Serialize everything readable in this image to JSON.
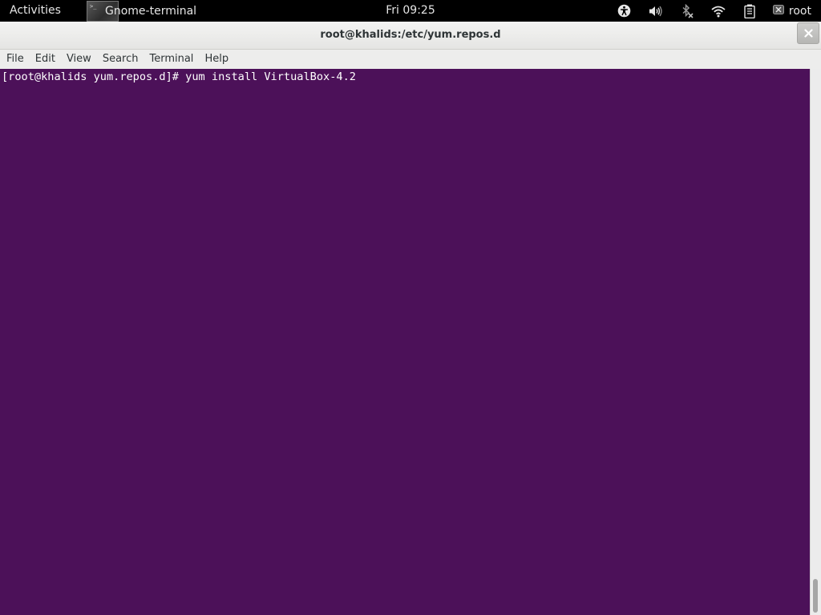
{
  "topbar": {
    "activities": "Activities",
    "app_name": "Gnome-terminal",
    "app_icon_prompt": ">_",
    "clock": "Fri 09:25",
    "user": "root"
  },
  "window": {
    "title": "root@khalids:/etc/yum.repos.d"
  },
  "menu": {
    "items": [
      "File",
      "Edit",
      "View",
      "Search",
      "Terminal",
      "Help"
    ]
  },
  "terminal": {
    "lines": [
      "[root@khalids yum.repos.d]# yum install VirtualBox-4.2"
    ],
    "background": "#4c1159",
    "foreground": "#ffffff"
  },
  "icons": {
    "status": [
      "accessibility-icon",
      "volume-icon",
      "bluetooth-disabled-icon",
      "wifi-icon",
      "battery-icon",
      "user-status-icon"
    ],
    "close": "close-icon"
  },
  "scroll": {
    "position_fraction": 0.93
  }
}
